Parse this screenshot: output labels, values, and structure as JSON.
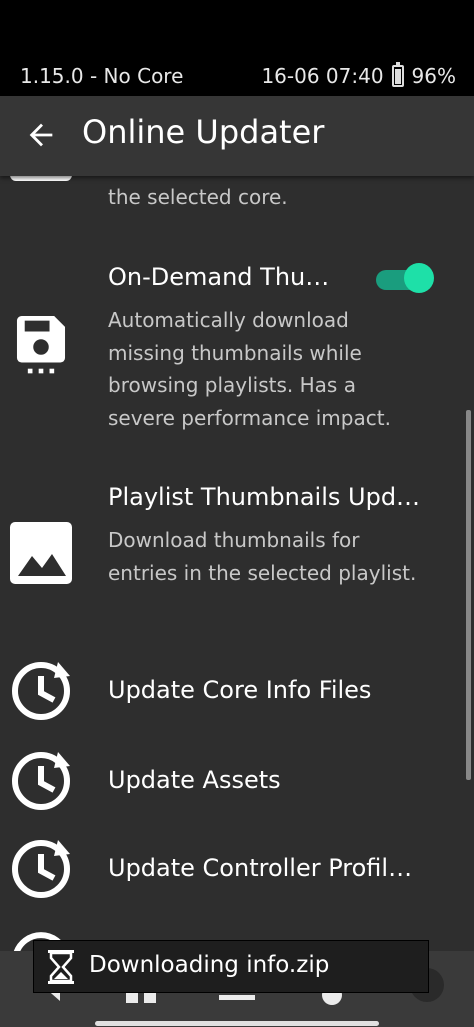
{
  "statusbar": {
    "left_text": "1.15.0 - No Core",
    "datetime": "16-06 07:40",
    "battery": "96%",
    "battery_level": 0.96
  },
  "appbar": {
    "title": "Online Updater",
    "back_icon": "arrow-back-icon"
  },
  "items": [
    {
      "desc": "the selected core.",
      "icon": "floppy-disk-icon"
    },
    {
      "title": "On-Demand Thu…",
      "desc": "Automatically download missing thumbnails while browsing playlists. Has a severe performance impact.",
      "icon": "floppy-disk-icon",
      "toggle": true
    },
    {
      "title": "Playlist Thumbnails Upd…",
      "desc": "Download thumbnails for entries in the selected playlist.",
      "icon": "image-icon"
    },
    {
      "title": "Update Core Info Files",
      "icon": "history-icon"
    },
    {
      "title": "Update Assets",
      "icon": "history-icon"
    },
    {
      "title": "Update Controller Profil…",
      "icon": "history-icon"
    }
  ],
  "toast": {
    "text": "Downloading info.zip",
    "icon": "hourglass-icon"
  },
  "colors": {
    "background": "#2e2e2e",
    "appbar": "#363636",
    "toggle_accent": "#1ee0a8"
  }
}
